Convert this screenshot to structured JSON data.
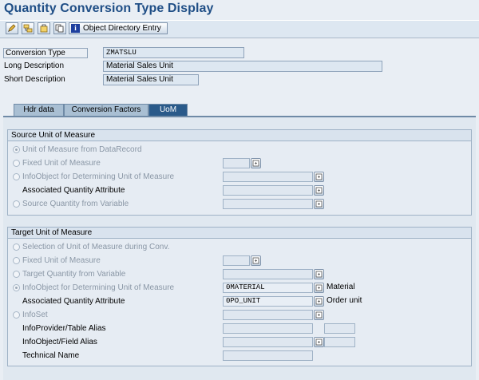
{
  "page": {
    "title": "Quantity Conversion Type Display"
  },
  "toolbar": {
    "object_directory_label": "Object Directory Entry"
  },
  "header_fields": [
    {
      "label": "Conversion Type",
      "value": "ZMATSLU"
    },
    {
      "label": "Long Description",
      "value": "Material Sales Unit"
    },
    {
      "label": "Short Description",
      "value": "Material Sales Unit"
    }
  ],
  "tabs": [
    {
      "label": "Hdr data",
      "active": false
    },
    {
      "label": "Conversion Factors",
      "active": false
    },
    {
      "label": "UoM",
      "active": true
    }
  ],
  "source_group": {
    "title": "Source Unit of Measure",
    "rows": [
      {
        "label": "Unit of Measure from DataRecord",
        "selected": true
      },
      {
        "label": "Fixed Unit of Measure",
        "selected": false
      },
      {
        "label": "InfoObject for Determining Unit of Measure",
        "selected": false
      },
      {
        "label": "Associated Quantity Attribute"
      },
      {
        "label": "Source Quantity from Variable",
        "selected": false
      }
    ]
  },
  "target_group": {
    "title": "Target Unit of Measure",
    "rows": [
      {
        "label": "Selection of Unit of Measure during Conv.",
        "selected": false
      },
      {
        "label": "Fixed Unit of Measure",
        "selected": false
      },
      {
        "label": "Target Quantity from Variable",
        "selected": false
      },
      {
        "label": "InfoObject for Determining Unit of Measure",
        "selected": true,
        "value": "0MATERIAL",
        "text": "Material"
      },
      {
        "label": "Associated Quantity Attribute",
        "value": "0PO_UNIT",
        "text": "Order unit"
      },
      {
        "label": "InfoSet",
        "selected": false
      },
      {
        "label": "InfoProvider/Table Alias"
      },
      {
        "label": "InfoObject/Field Alias"
      },
      {
        "label": "Technical Name"
      }
    ]
  },
  "icons": [
    "edit-pencil-icon",
    "object-hierarchy-icon",
    "where-used-icon",
    "copy-icon",
    "information-icon",
    "value-help-icon"
  ]
}
